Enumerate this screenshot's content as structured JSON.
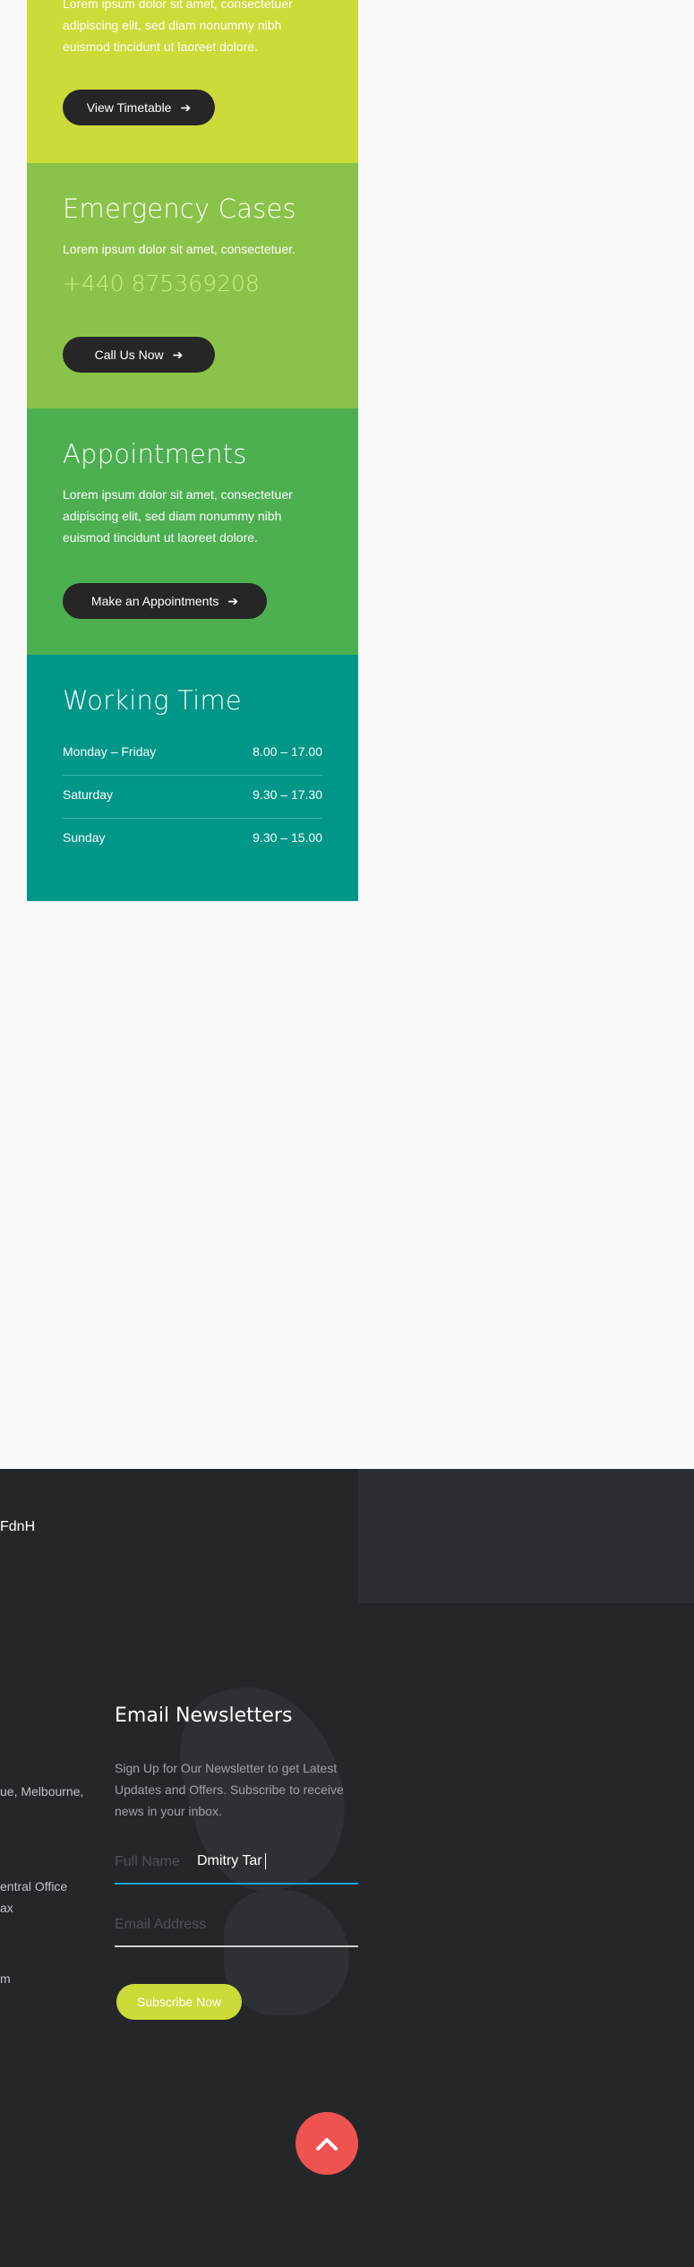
{
  "timetable": {
    "text": "Lorem ipsum dolor sit amet, consectetuer adipiscing elit, sed diam nonummy nibh euismod tincidunt ut laoreet dolore.",
    "button_label": "View Timetable"
  },
  "emergency": {
    "title": "Emergency Cases",
    "text": "Lorem ipsum dolor sit amet, consectetuer.",
    "phone": "+440 875369208",
    "button_label": "Call Us Now"
  },
  "appointments": {
    "title": "Appointments",
    "text": "Lorem ipsum dolor sit amet, consectetuer adipiscing elit, sed diam nonummy nibh euismod tincidunt ut laoreet dolore.",
    "button_label": "Make an Appointments"
  },
  "working_time": {
    "title": "Working Time",
    "rows": [
      {
        "day": "Monday – Friday",
        "hours": "8.00 – 17.00"
      },
      {
        "day": "Saturday",
        "hours": "9.30 – 17.30"
      },
      {
        "day": "Sunday",
        "hours": "9.30 – 15.00"
      }
    ]
  },
  "footer": {
    "brand": "FdnH",
    "address_fragment": "ue, Melbourne,",
    "office_fragment_1": "entral Office",
    "office_fragment_2": "ax",
    "email_fragment": "m",
    "newsletter": {
      "title": "Email Newsletters",
      "text": "Sign Up for Our Newsletter to get Latest Updates and Offers. Subscribe to receive news in your inbox.",
      "name_placeholder": "Full Name",
      "name_value": "Dmitry Tar",
      "email_placeholder": "Email Address",
      "button_label": "Subscribe Now"
    }
  },
  "colors": {
    "lime": "#cddb38",
    "light_green": "#8bc34a",
    "green": "#4caf50",
    "teal": "#009688",
    "footer_bg": "#24272a",
    "scroll_top": "#ef5350",
    "focus": "#1ba6e0"
  },
  "icons": {
    "button_arrow": "arrow-right-icon",
    "scroll_top": "chevron-up-icon"
  }
}
